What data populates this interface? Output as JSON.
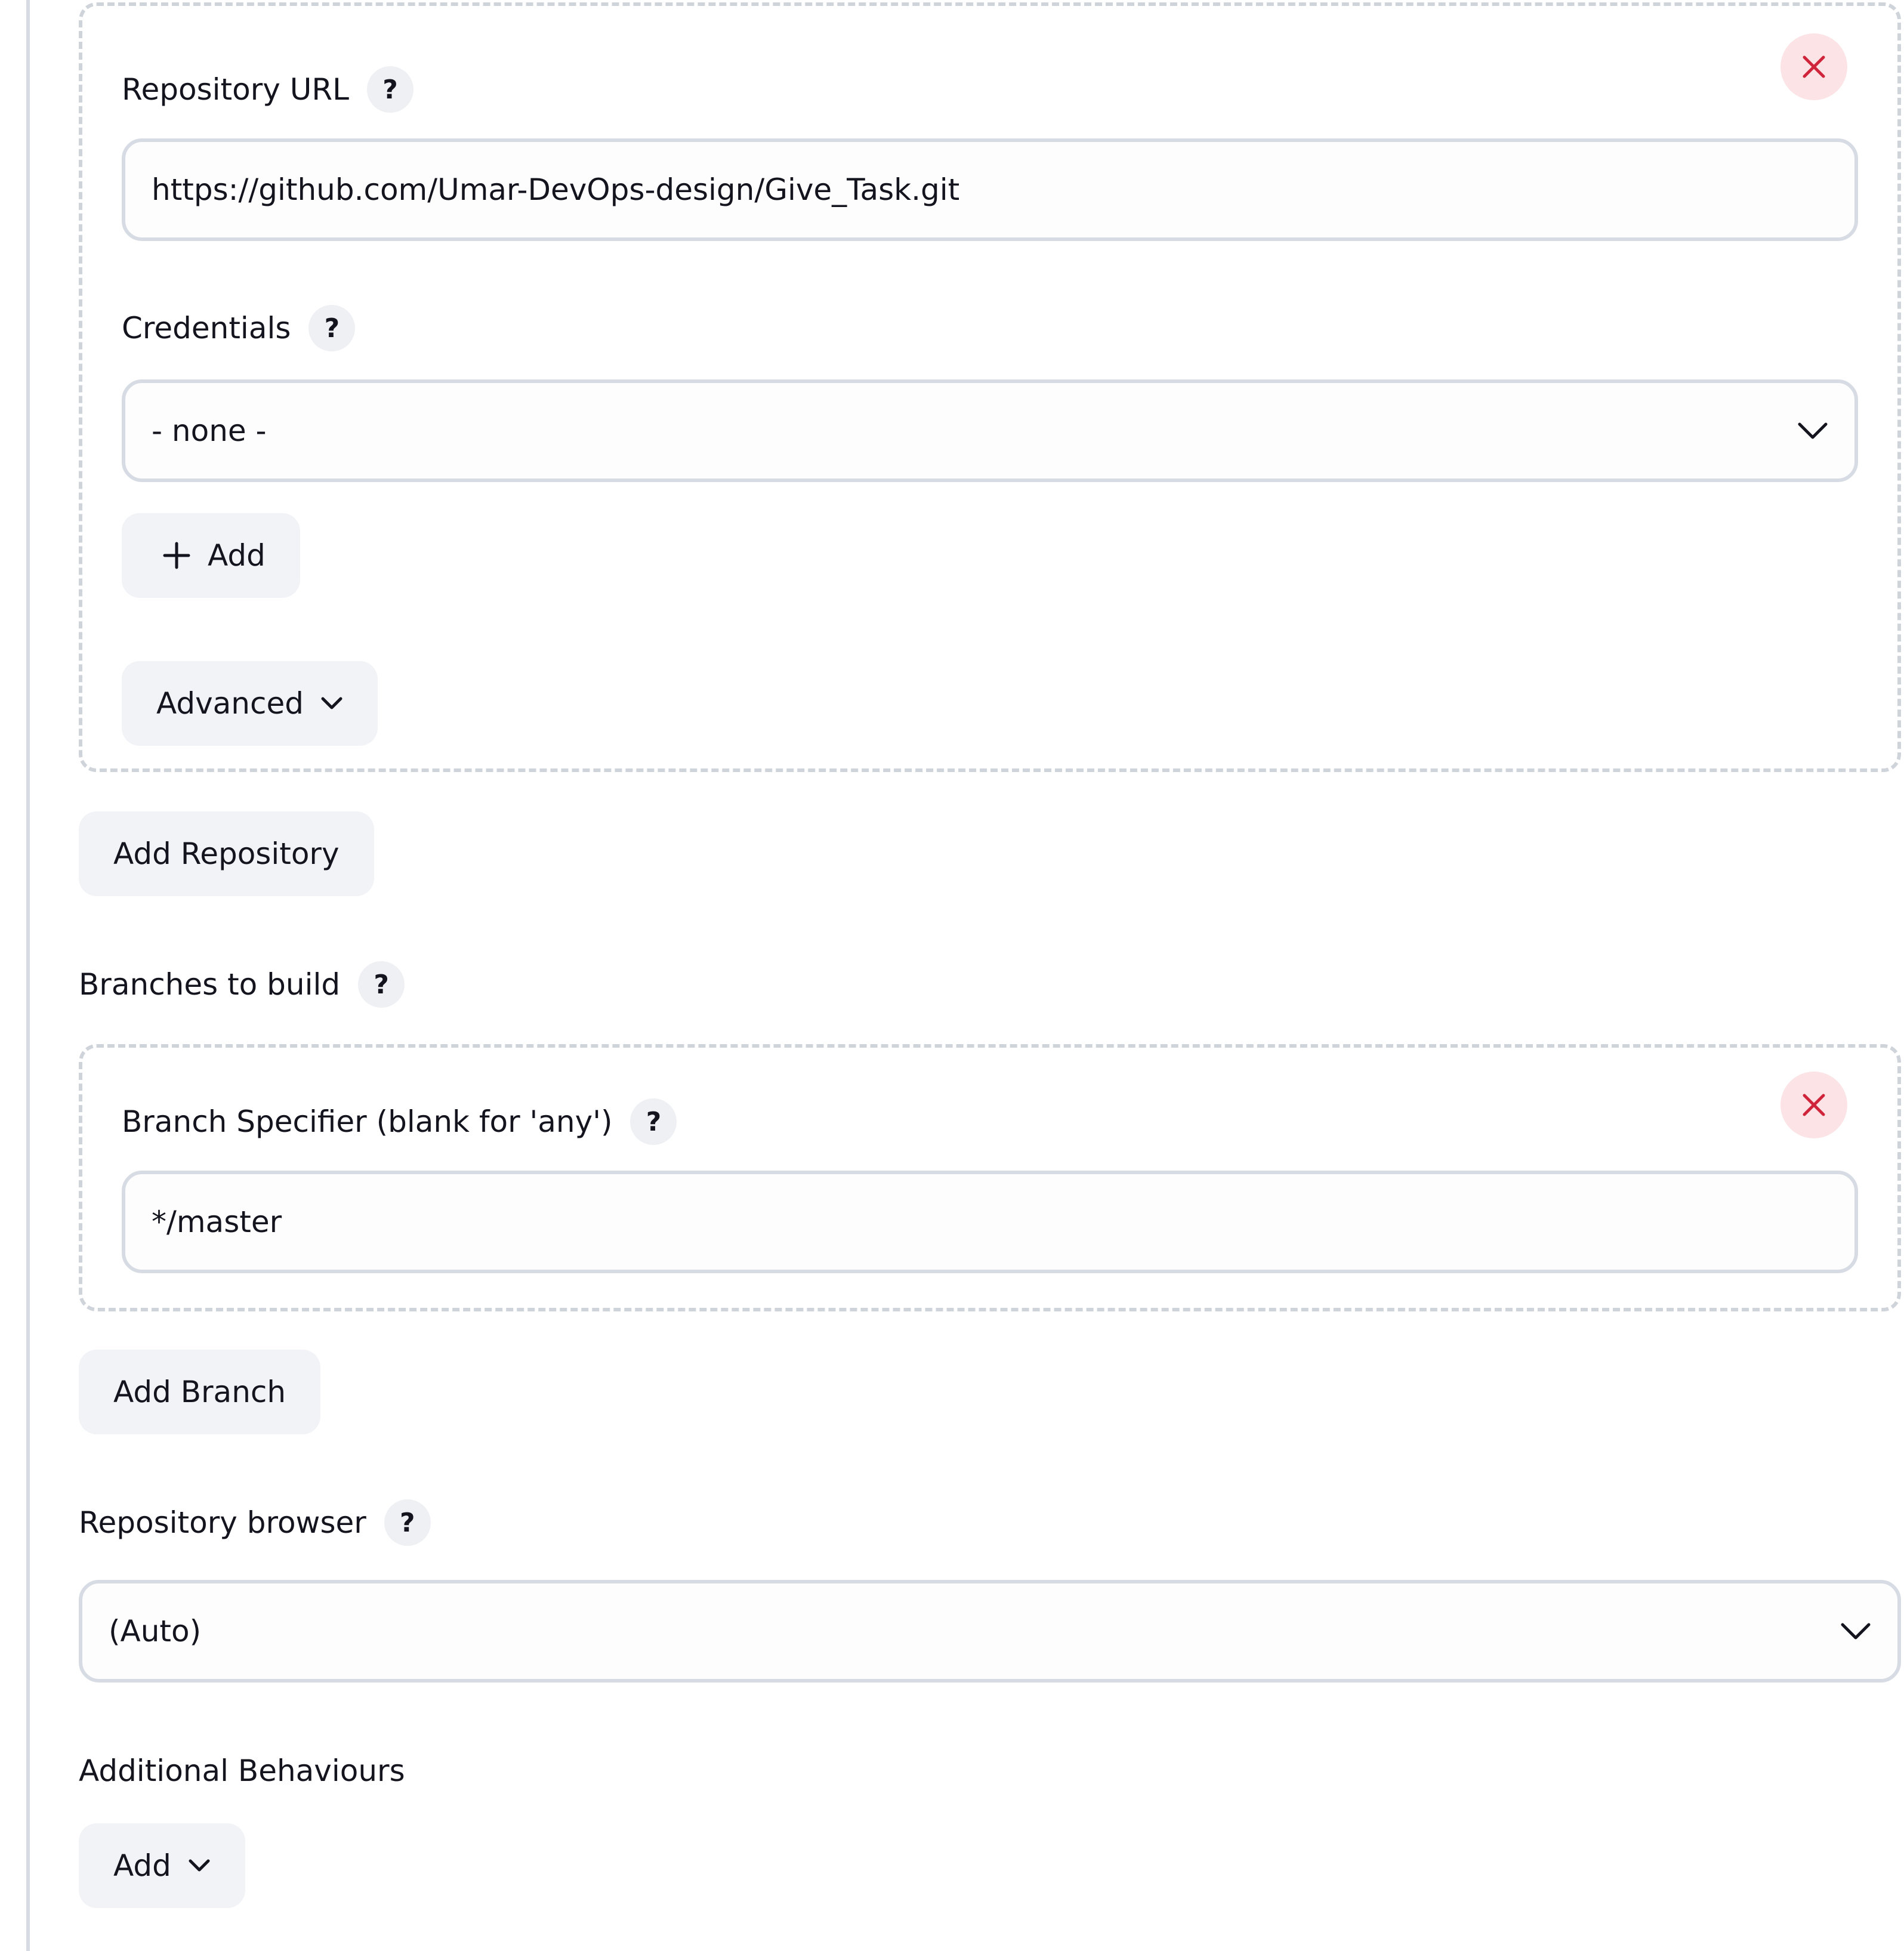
{
  "repository": {
    "url_label": "Repository URL",
    "url_value": "https://github.com/Umar-DevOps-design/Give_Task.git",
    "credentials_label": "Credentials",
    "credentials_value": "- none -",
    "add_label": "Add",
    "advanced_label": "Advanced"
  },
  "add_repository_label": "Add Repository",
  "branches": {
    "section_label": "Branches to build",
    "specifier_label": "Branch Specifier (blank for 'any')",
    "specifier_value": "*/master",
    "add_branch_label": "Add Branch"
  },
  "browser": {
    "label": "Repository browser",
    "value": "(Auto)"
  },
  "additional": {
    "label": "Additional Behaviours",
    "add_label": "Add"
  },
  "help_symbol": "?",
  "colors": {
    "close_icon": "#d0243a",
    "close_bg": "#fbe3e6",
    "border": "#d7dbe3",
    "dashed_border": "#cfd3da",
    "button_bg": "#f2f3f7",
    "text": "#14141f"
  },
  "icons": {
    "close": "x-icon",
    "help": "question-icon",
    "dropdown": "chevron-down-icon",
    "add": "plus-icon"
  }
}
